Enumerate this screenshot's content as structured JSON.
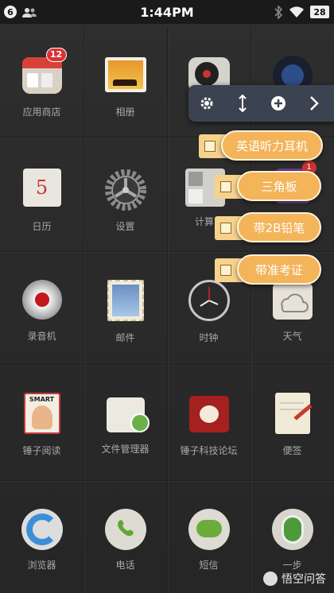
{
  "status_bar": {
    "notification_count": "6",
    "time": "1:44PM",
    "battery": "28"
  },
  "apps": [
    {
      "label": "应用商店",
      "icon": "app-store-icon",
      "badge": "12"
    },
    {
      "label": "相册",
      "icon": "gallery-icon"
    },
    {
      "label": "",
      "icon": "record-player-icon"
    },
    {
      "label": "",
      "icon": "camera-icon"
    },
    {
      "label": "日历",
      "icon": "calendar-icon",
      "day": "5"
    },
    {
      "label": "设置",
      "icon": "gear-icon"
    },
    {
      "label": "计算",
      "icon": "calculator-icon"
    },
    {
      "label": "",
      "icon": "folder-icon",
      "badge": "1"
    },
    {
      "label": "录音机",
      "icon": "recorder-icon"
    },
    {
      "label": "邮件",
      "icon": "mail-stamp-icon"
    },
    {
      "label": "时钟",
      "icon": "clock-icon"
    },
    {
      "label": "天气",
      "icon": "weather-icon"
    },
    {
      "label": "锤子阅读",
      "icon": "reader-icon",
      "sign": "SMART"
    },
    {
      "label": "文件管理器",
      "icon": "file-manager-icon"
    },
    {
      "label": "锤子科技论坛",
      "icon": "forum-icon"
    },
    {
      "label": "便签",
      "icon": "notes-icon"
    },
    {
      "label": "浏览器",
      "icon": "browser-icon"
    },
    {
      "label": "电话",
      "icon": "phone-icon"
    },
    {
      "label": "短信",
      "icon": "sms-icon"
    },
    {
      "label": "一步",
      "icon": "one-step-icon"
    }
  ],
  "toolbar": {
    "buttons": [
      "gear-icon",
      "resize-icon",
      "add-icon",
      "next-icon"
    ]
  },
  "todos": [
    {
      "text": "英语听力耳机"
    },
    {
      "text": "三角板"
    },
    {
      "text": "带2B铅笔"
    },
    {
      "text": "带准考证"
    }
  ],
  "watermark": {
    "text": "悟空问答"
  },
  "colors": {
    "todo_fill": "#f3b45a",
    "todo_border": "#fff3d8",
    "toolbar": "#3c4350"
  }
}
